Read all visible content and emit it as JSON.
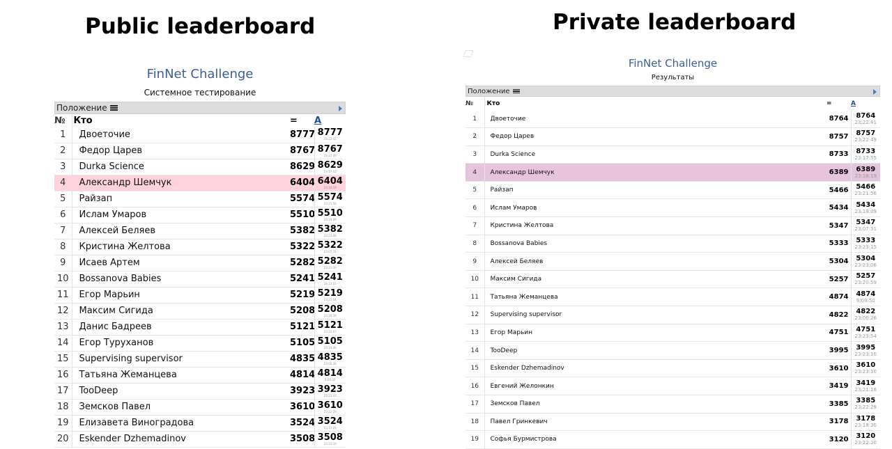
{
  "headings": {
    "public": "Public leaderboard",
    "private": "Private leaderboard"
  },
  "public_board": {
    "title": "FinNet Challenge",
    "subtitle": "Системное тестирование",
    "position_label": "Положение",
    "columns": {
      "num": "№",
      "who": "Кто",
      "eq": "=",
      "a": "A"
    },
    "highlight_rank": 4,
    "rows": [
      {
        "rank": "1",
        "name": "Двоеточие",
        "score": "8777",
        "a": "8777",
        "t": "23:22:41"
      },
      {
        "rank": "2",
        "name": "Федор Царев",
        "score": "8767",
        "a": "8767",
        "t": "23:22:49"
      },
      {
        "rank": "3",
        "name": "Durka Science",
        "score": "8629",
        "a": "8629",
        "t": "23:17:55"
      },
      {
        "rank": "4",
        "name": "Александр Шемчук",
        "score": "6404",
        "a": "6404",
        "t": "23:18:19"
      },
      {
        "rank": "5",
        "name": "Райзап",
        "score": "5574",
        "a": "5574",
        "t": "23:21:56"
      },
      {
        "rank": "6",
        "name": "Ислам Умаров",
        "score": "5510",
        "a": "5510",
        "t": "23:19:09"
      },
      {
        "rank": "7",
        "name": "Алексей Беляев",
        "score": "5382",
        "a": "5382",
        "t": "23:23:06"
      },
      {
        "rank": "8",
        "name": "Кристина Желтова",
        "score": "5322",
        "a": "5322",
        "t": "23:07:31"
      },
      {
        "rank": "9",
        "name": "Исаев Артем",
        "score": "5282",
        "a": "5282",
        "t": "23:21:59"
      },
      {
        "rank": "10",
        "name": "Bossanova Babies",
        "score": "5241",
        "a": "5241",
        "t": "23:23:15"
      },
      {
        "rank": "11",
        "name": "Егор Марьин",
        "score": "5219",
        "a": "5219",
        "t": "23:23:54"
      },
      {
        "rank": "12",
        "name": "Максим Сигида",
        "score": "5208",
        "a": "5208",
        "t": "23:20:59"
      },
      {
        "rank": "13",
        "name": "Данис Бадреев",
        "score": "5121",
        "a": "5121",
        "t": "23:22:07"
      },
      {
        "rank": "14",
        "name": "Егор Туруханов",
        "score": "5105",
        "a": "5105",
        "t": "23:10:46"
      },
      {
        "rank": "15",
        "name": "Supervising supervisor",
        "score": "4835",
        "a": "4835",
        "t": "23:00:26"
      },
      {
        "rank": "16",
        "name": "Татьяна Жеманцева",
        "score": "4814",
        "a": "4814",
        "t": "9:09:50"
      },
      {
        "rank": "17",
        "name": "TooDeep",
        "score": "3923",
        "a": "3923",
        "t": "23:23:10"
      },
      {
        "rank": "18",
        "name": "Земсков Павел",
        "score": "3610",
        "a": "3610",
        "t": "23:22:28"
      },
      {
        "rank": "19",
        "name": "Елизавета Виноградова",
        "score": "3524",
        "a": "3524",
        "t": "23:11:26"
      },
      {
        "rank": "20",
        "name": "Eskender Dzhemadinov",
        "score": "3508",
        "a": "3508",
        "t": "23:23:10"
      }
    ]
  },
  "private_board": {
    "title": "FinNet Challenge",
    "subtitle": "Результаты",
    "position_label": "Положение",
    "columns": {
      "num": "№",
      "who": "Кто",
      "eq": "=",
      "a": "A"
    },
    "highlight_rank": 4,
    "rows": [
      {
        "rank": "1",
        "name": "Двоеточие",
        "score": "8764",
        "a": "8764",
        "t": "23:22:41"
      },
      {
        "rank": "2",
        "name": "Федор Царев",
        "score": "8757",
        "a": "8757",
        "t": "23:22:49"
      },
      {
        "rank": "3",
        "name": "Durka Science",
        "score": "8733",
        "a": "8733",
        "t": "23:17:55"
      },
      {
        "rank": "4",
        "name": "Александр Шемчук",
        "score": "6389",
        "a": "6389",
        "t": "23:18:19"
      },
      {
        "rank": "5",
        "name": "Райзап",
        "score": "5466",
        "a": "5466",
        "t": "23:21:56"
      },
      {
        "rank": "6",
        "name": "Ислам Умаров",
        "score": "5434",
        "a": "5434",
        "t": "23:19:09"
      },
      {
        "rank": "7",
        "name": "Кристина Желтова",
        "score": "5347",
        "a": "5347",
        "t": "23:07:31"
      },
      {
        "rank": "8",
        "name": "Bossanova Babies",
        "score": "5333",
        "a": "5333",
        "t": "23:23:15"
      },
      {
        "rank": "9",
        "name": "Алексей Беляев",
        "score": "5304",
        "a": "5304",
        "t": "23:23:06"
      },
      {
        "rank": "10",
        "name": "Максим Сигида",
        "score": "5257",
        "a": "5257",
        "t": "23:20:59"
      },
      {
        "rank": "11",
        "name": "Татьяна Жеманцева",
        "score": "4874",
        "a": "4874",
        "t": "9:09:50"
      },
      {
        "rank": "12",
        "name": "Supervising supervisor",
        "score": "4822",
        "a": "4822",
        "t": "23:00:26"
      },
      {
        "rank": "13",
        "name": "Егор Марьин",
        "score": "4751",
        "a": "4751",
        "t": "23:23:54"
      },
      {
        "rank": "14",
        "name": "TooDeep",
        "score": "3995",
        "a": "3995",
        "t": "23:23:10"
      },
      {
        "rank": "15",
        "name": "Eskender Dzhemadinov",
        "score": "3610",
        "a": "3610",
        "t": "23:23:10"
      },
      {
        "rank": "16",
        "name": "Евгений Желонкин",
        "score": "3419",
        "a": "3419",
        "t": "23:21:16"
      },
      {
        "rank": "17",
        "name": "Земсков Павел",
        "score": "3385",
        "a": "3385",
        "t": "23:22:28"
      },
      {
        "rank": "18",
        "name": "Павел Гринкевич",
        "score": "3178",
        "a": "3178",
        "t": "23:18:30"
      },
      {
        "rank": "19",
        "name": "Софья Бурмистрова",
        "score": "3120",
        "a": "3120",
        "t": "23:22:20"
      }
    ]
  }
}
